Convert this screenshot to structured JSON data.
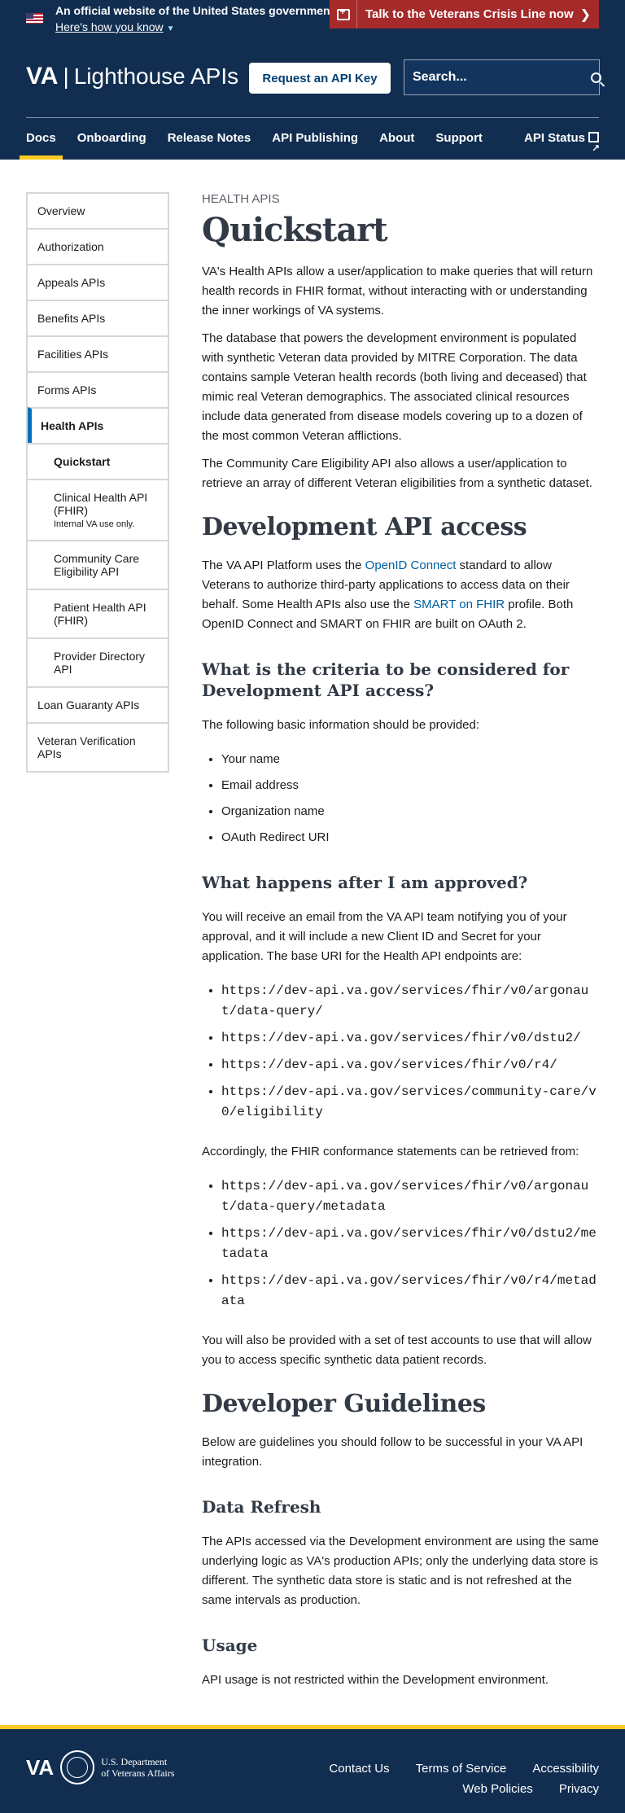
{
  "banner": {
    "official": "An official website of the United States government.",
    "how_know": "Here's how you know",
    "crisis": "Talk to the Veterans Crisis Line now"
  },
  "header": {
    "logo_va": "VA",
    "logo_text": "Lighthouse APIs",
    "request_key": "Request an API Key",
    "search_placeholder": "Search...",
    "nav": [
      "Docs",
      "Onboarding",
      "Release Notes",
      "API Publishing",
      "About",
      "Support"
    ],
    "status": "API Status"
  },
  "sidebar": {
    "items": [
      {
        "label": "Overview"
      },
      {
        "label": "Authorization"
      },
      {
        "label": "Appeals APIs"
      },
      {
        "label": "Benefits APIs"
      },
      {
        "label": "Facilities APIs"
      },
      {
        "label": "Forms APIs"
      },
      {
        "label": "Health APIs"
      },
      {
        "label": "Quickstart"
      },
      {
        "label": "Clinical Health API (FHIR)",
        "note": "Internal VA use only."
      },
      {
        "label": "Community Care Eligibility API"
      },
      {
        "label": "Patient Health API (FHIR)"
      },
      {
        "label": "Provider Directory API"
      },
      {
        "label": "Loan Guaranty APIs"
      },
      {
        "label": "Veteran Verification APIs"
      }
    ]
  },
  "content": {
    "eyebrow": "Health APIs",
    "title": "Quickstart",
    "intro1": "VA's Health APIs allow a user/application to make queries that will return health records in FHIR format, without interacting with or understanding the inner workings of VA systems.",
    "intro2": "The database that powers the development environment is populated with synthetic Veteran data provided by MITRE Corporation. The data contains sample Veteran health records (both living and deceased) that mimic real Veteran demographics. The associated clinical resources include data generated from disease models covering up to a dozen of the most common Veteran afflictions.",
    "intro3": "The Community Care Eligibility API also allows a user/application to retrieve an array of different Veteran eligibilities from a synthetic dataset.",
    "dev_heading": "Development API access",
    "dev_p_1": "The VA API Platform uses the ",
    "dev_link_openid": "OpenID Connect",
    "dev_p_2": " standard to allow Veterans to authorize third-party applications to access data on their behalf. Some Health APIs also use the ",
    "dev_link_smart": "SMART on FHIR",
    "dev_p_3": " profile. Both OpenID Connect and SMART on FHIR are built on OAuth 2.",
    "criteria_heading": "What is the criteria to be considered for Development API access?",
    "criteria_p": "The following basic information should be provided:",
    "criteria_list": [
      "Your name",
      "Email address",
      "Organization name",
      "OAuth Redirect URI"
    ],
    "approved_heading": "What happens after I am approved?",
    "approved_p": "You will receive an email from the VA API team notifying you of your approval, and it will include a new Client ID and Secret for your application. The base URI for the Health API endpoints are:",
    "base_uris": [
      "https://dev-api.va.gov/services/fhir/v0/argonaut/data-query/",
      "https://dev-api.va.gov/services/fhir/v0/dstu2/",
      "https://dev-api.va.gov/services/fhir/v0/r4/",
      "https://dev-api.va.gov/services/community-care/v0/eligibility"
    ],
    "conformance_p": "Accordingly, the FHIR conformance statements can be retrieved from:",
    "conformance_uris": [
      "https://dev-api.va.gov/services/fhir/v0/argonaut/data-query/metadata",
      "https://dev-api.va.gov/services/fhir/v0/dstu2/metadata",
      "https://dev-api.va.gov/services/fhir/v0/r4/metadata"
    ],
    "test_accounts_p": "You will also be provided with a set of test accounts to use that will allow you to access specific synthetic data patient records.",
    "guidelines_heading": "Developer Guidelines",
    "guidelines_p": "Below are guidelines you should follow to be successful in your VA API integration.",
    "refresh_heading": "Data Refresh",
    "refresh_p": "The APIs accessed via the Development environment are using the same underlying logic as VA's production APIs; only the underlying data store is different. The synthetic data store is static and is not refreshed at the same intervals as production.",
    "usage_heading": "Usage",
    "usage_p": "API usage is not restricted within the Development environment."
  },
  "footer": {
    "logo_va": "VA",
    "dept_line1": "U.S. Department",
    "dept_line2": "of Veterans Affairs",
    "links": [
      "Contact Us",
      "Terms of Service",
      "Accessibility",
      "Web Policies",
      "Privacy"
    ]
  }
}
